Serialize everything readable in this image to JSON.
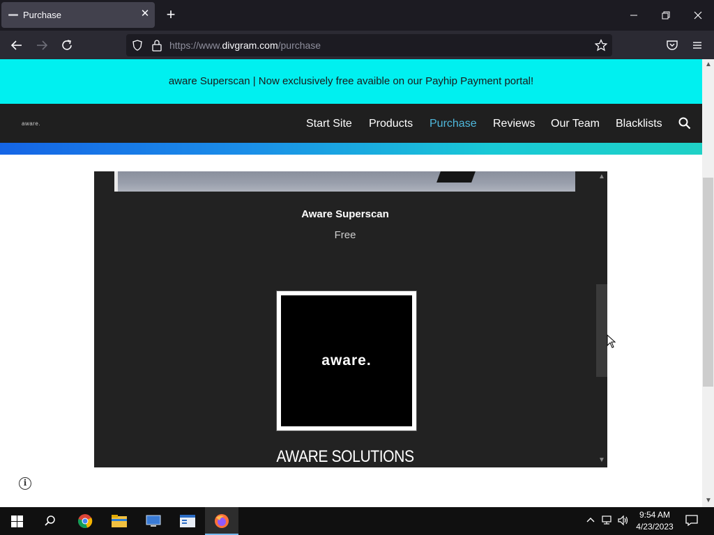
{
  "browser": {
    "tab_title": "Purchase",
    "url_prefix": "https://www.",
    "url_host": "divgram.com",
    "url_path": "/purchase"
  },
  "site": {
    "banner_text": "aware Superscan | Now exclusively free avaible on our Payhip Payment portal!",
    "logo_text": "aware.",
    "nav": [
      {
        "label": "Start Site",
        "active": false
      },
      {
        "label": "Products",
        "active": false
      },
      {
        "label": "Purchase",
        "active": true
      },
      {
        "label": "Reviews",
        "active": false
      },
      {
        "label": "Our Team",
        "active": false
      },
      {
        "label": "Blacklists",
        "active": false
      }
    ],
    "accent_color": "#00f0f0",
    "active_nav_color": "#4fb8dc"
  },
  "product": {
    "name": "Aware Superscan",
    "price": "Free",
    "logo_text": "aware.",
    "company": "AWARE SOLUTIONS"
  },
  "taskbar": {
    "time": "9:54 AM",
    "date": "4/23/2023"
  }
}
